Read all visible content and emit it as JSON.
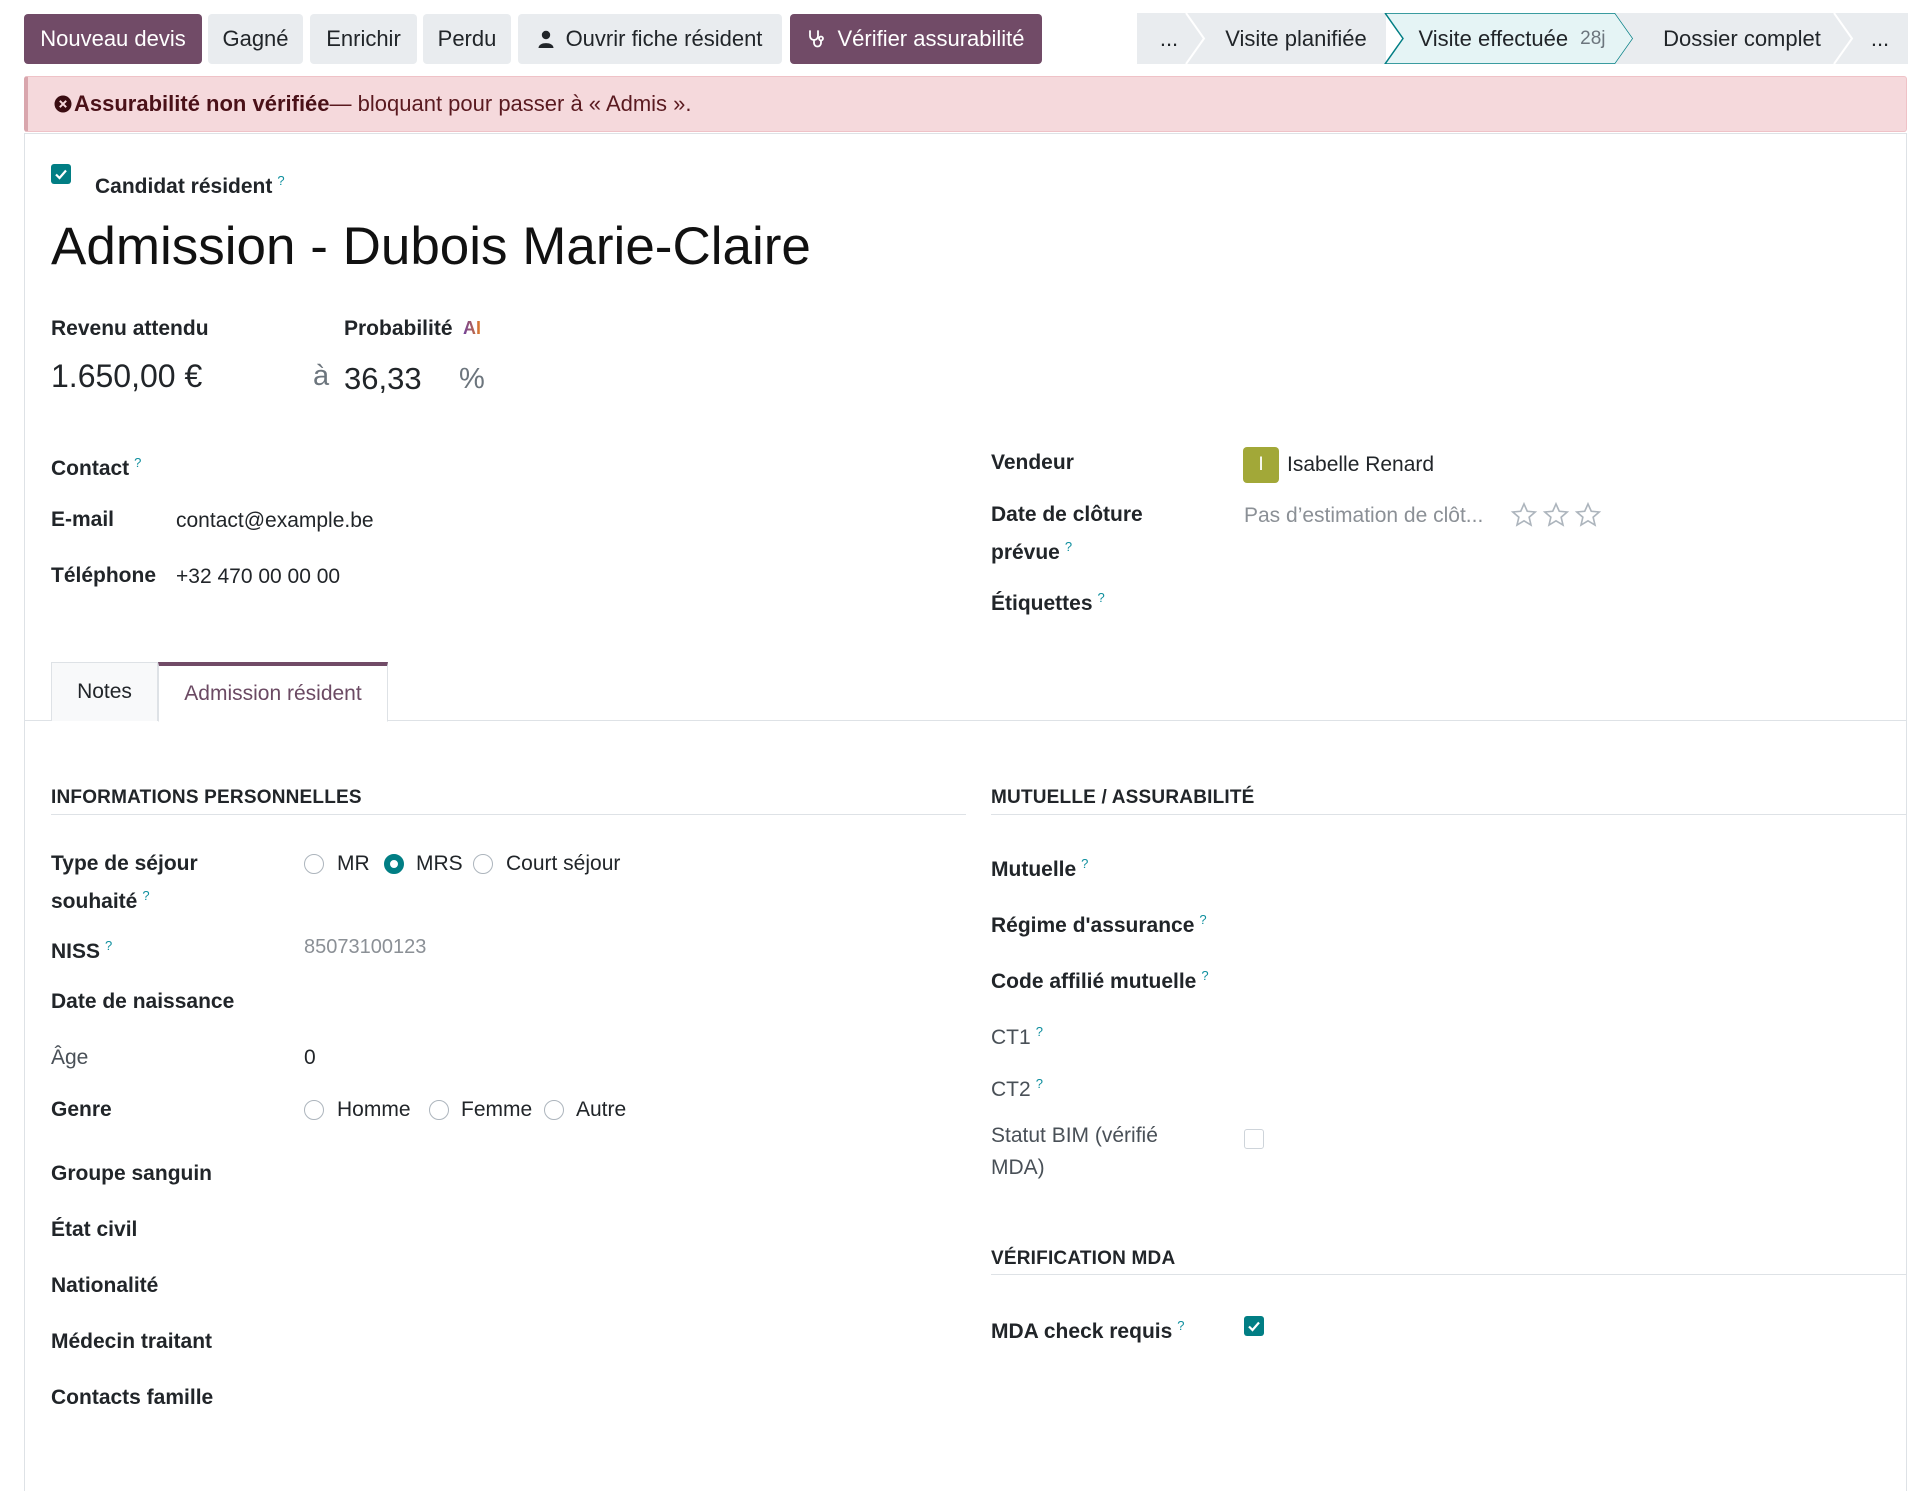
{
  "toolbar": {
    "new_quote": "Nouveau devis",
    "won": "Gagné",
    "enrich": "Enrichir",
    "lost": "Perdu",
    "open_resident": "Ouvrir fiche résident",
    "verify_insurability": "Vérifier assurabilité"
  },
  "stages": {
    "more_left": "...",
    "planned_visit": "Visite planifiée",
    "visit_done": "Visite effectuée",
    "visit_done_count": "28j",
    "file_complete": "Dossier complet",
    "more_right": "..."
  },
  "alert": {
    "title": "Assurabilité non vérifiée",
    "message": " — bloquant pour passer à « Admis »."
  },
  "form": {
    "candidate_label": "Candidat résident",
    "title": "Admission - Dubois Marie-Claire",
    "expected_revenue_label": "Revenu attendu",
    "expected_revenue": "1.650,00 €",
    "probability_label": "Probabilité",
    "probability_ai": "AI",
    "probability_prefix": "à",
    "probability": "36,33",
    "percent": "%",
    "contact_label": "Contact",
    "email_label": "E-mail",
    "email": "contact@example.be",
    "phone_label": "Téléphone",
    "phone": "+32 470 00 00 00",
    "salesperson_label": "Vendeur",
    "salesperson_initial": "I",
    "salesperson": "Isabelle Renard",
    "closing_label_1": "Date de clôture",
    "closing_label_2": "prévue",
    "closing_placeholder": "Pas d’estimation de clôt...",
    "tags_label": "Étiquettes"
  },
  "tabs": {
    "notes": "Notes",
    "admission": "Admission résident"
  },
  "personal": {
    "section": "INFORMATIONS PERSONNELLES",
    "stay_type_label_1": "Type de séjour",
    "stay_type_label_2": "souhaité",
    "stay_options": [
      "MR",
      "MRS",
      "Court séjour"
    ],
    "stay_selected": "MRS",
    "niss_label": "NISS",
    "niss_placeholder": "85073100123",
    "birth_label": "Date de naissance",
    "age_label": "Âge",
    "age": "0",
    "gender_label": "Genre",
    "gender_options": [
      "Homme",
      "Femme",
      "Autre"
    ],
    "blood_label": "Groupe sanguin",
    "civil_label": "État civil",
    "nationality_label": "Nationalité",
    "doctor_label": "Médecin traitant",
    "family_label": "Contacts famille"
  },
  "insurance": {
    "section": "MUTUELLE / ASSURABILITÉ",
    "mutual_label": "Mutuelle",
    "regime_label": "Régime d'assurance",
    "member_code_label": "Code affilié mutuelle",
    "ct1_label": "CT1",
    "ct2_label": "CT2",
    "bim_label_1": "Statut BIM (vérifié",
    "bim_label_2": "MDA)",
    "bim_checked": false
  },
  "mda": {
    "section": "VÉRIFICATION MDA",
    "check_label": "MDA check requis",
    "check_checked": true
  },
  "colors": {
    "primary": "#714b67",
    "teal": "#017e84",
    "alert_bg": "#f5d9dc"
  }
}
